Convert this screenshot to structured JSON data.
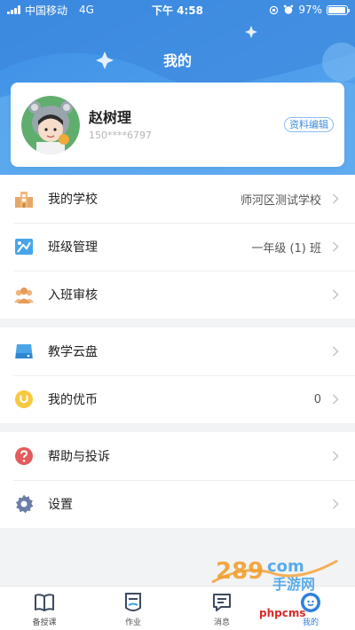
{
  "status_bar": {
    "carrier": "中国移动",
    "network": "4G",
    "time": "下午 4:58",
    "battery": "97%",
    "battery_level": 0.97
  },
  "header": {
    "title": "我的"
  },
  "profile": {
    "name": "赵树理",
    "phone": "150****6797",
    "edit_label": "资料编辑"
  },
  "menu_groups": [
    {
      "items": [
        {
          "label": "我的学校",
          "value": "师河区测试学校",
          "icon": "school-building-icon"
        },
        {
          "label": "班级管理",
          "value": "一年级 (1) 班",
          "icon": "class-management-icon"
        },
        {
          "label": "入班审核",
          "value": "",
          "icon": "group-review-icon"
        }
      ]
    },
    {
      "items": [
        {
          "label": "教学云盘",
          "value": "",
          "icon": "cloud-drive-icon"
        },
        {
          "label": "我的优币",
          "value": "0",
          "icon": "coin-icon"
        }
      ]
    },
    {
      "items": [
        {
          "label": "帮助与投诉",
          "value": "",
          "icon": "help-icon"
        },
        {
          "label": "设置",
          "value": "",
          "icon": "settings-gear-icon"
        }
      ]
    }
  ],
  "tabs": [
    {
      "label": "备授课",
      "icon": "book-icon",
      "active": false
    },
    {
      "label": "作业",
      "icon": "homework-icon",
      "active": false
    },
    {
      "label": "消息",
      "icon": "message-icon",
      "active": false
    },
    {
      "label": "我的",
      "icon": "profile-icon",
      "active": true
    }
  ],
  "watermark": {
    "text": "phpcms"
  },
  "colors": {
    "header_blue": "#4a9ae8",
    "accent": "#2f7fe0",
    "edit_border": "#8cbcf0",
    "help_red": "#e35b5b",
    "coin_yellow": "#f7c842"
  }
}
